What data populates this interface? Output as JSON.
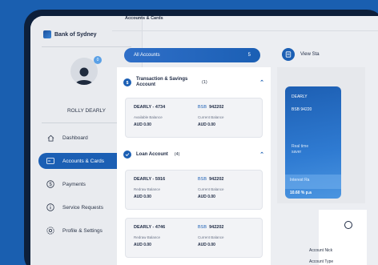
{
  "bank": {
    "name": "Bank of Sydney"
  },
  "user": {
    "name": "ROLLY DEARLY",
    "notification_count": "0"
  },
  "breadcrumb": "Accounts & Cards",
  "nav": [
    {
      "label": "Dashboard",
      "icon": "home-icon"
    },
    {
      "label": "Accounts & Cards",
      "icon": "card-icon",
      "active": true
    },
    {
      "label": "Payments",
      "icon": "dollar-icon"
    },
    {
      "label": "Service Requests",
      "icon": "info-icon"
    },
    {
      "label": "Profile & Settings",
      "icon": "gear-icon"
    }
  ],
  "accounts_selector": {
    "label": "All Accounts",
    "count": "5"
  },
  "groups": {
    "transaction": {
      "title": "Transaction & Savings Account",
      "count": "(1)",
      "accounts": [
        {
          "name": "DEARLY - 4734",
          "bsb_label": "BSB",
          "bsb": "942202",
          "left_label": "Available Balance",
          "right_label": "Current Balance",
          "left_value": "AUD 0.00",
          "right_value": "AUD 0.00"
        }
      ]
    },
    "loan": {
      "title": "Loan Account",
      "count": "(4)",
      "accounts": [
        {
          "name": "DEARLY - 5916",
          "bsb_label": "BSB",
          "bsb": "942202",
          "left_label": "Redraw Balance",
          "right_label": "Current Balance",
          "left_value": "AUD 0.00",
          "right_value": "AUD 0.00"
        },
        {
          "name": "DEARLY - 4746",
          "bsb_label": "BSB",
          "bsb": "942202",
          "left_label": "Redraw Balance",
          "right_label": "Current Balance",
          "left_value": "AUD 0.00",
          "right_value": "AUD 0.00"
        }
      ]
    }
  },
  "right": {
    "view_label": "View Sta",
    "card": {
      "name": "DEARLY",
      "bsb": "BSB  94220",
      "line1": "Real time",
      "line2": "saver",
      "band": "Interest Ra",
      "rate": "10.60 % p.a"
    },
    "nick": "Account Nick",
    "nick2": "Account Type"
  },
  "colors": {
    "primary": "#1b5fb4",
    "background": "#1a5fb0",
    "frame": "#0d1f3a"
  }
}
